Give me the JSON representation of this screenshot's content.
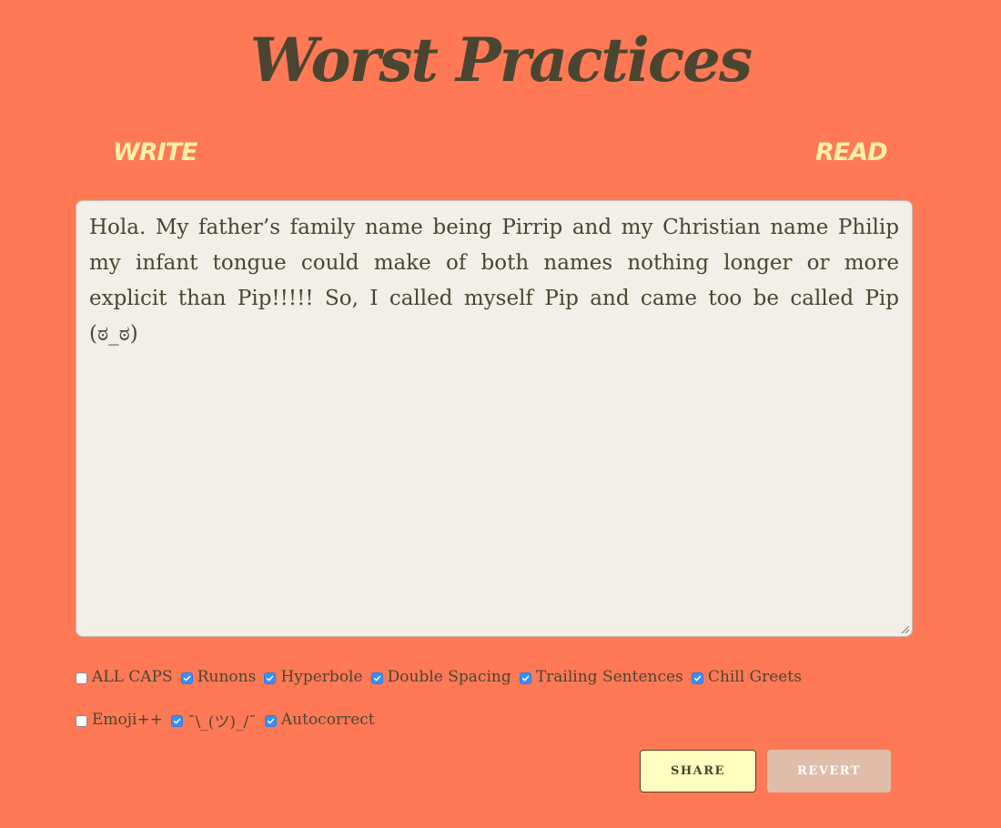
{
  "app": {
    "title": "Worst Practices"
  },
  "nav": {
    "write_label": "WRITE",
    "read_label": "READ"
  },
  "editor": {
    "text": "Hola. My father’s family name being Pirrip and my Christian name Philip my infant tongue could make of both names nothing longer or more explicit than Pip!!!!! So, I called myself Pip and came too be called Pip (ಠ_ಠ)"
  },
  "options": [
    {
      "label": "ALL CAPS",
      "checked": false
    },
    {
      "label": "Runons",
      "checked": true
    },
    {
      "label": "Hyperbole",
      "checked": true
    },
    {
      "label": "Double Spacing",
      "checked": true
    },
    {
      "label": "Trailing Sentences",
      "checked": true
    },
    {
      "label": "Chill Greets",
      "checked": true
    },
    {
      "label": "Emoji++",
      "checked": false
    },
    {
      "label": "¯\\_(ツ)_/¯",
      "checked": true
    },
    {
      "label": "Autocorrect",
      "checked": true
    }
  ],
  "buttons": {
    "share_label": "SHARE",
    "revert_label": "REVERT"
  },
  "colors": {
    "background": "#ff7956",
    "title": "#4a4530",
    "nav": "#fff0a6",
    "editor_bg": "#f2efe9",
    "checkbox_checked": "#3a8ef6",
    "share_bg": "#ffffbf",
    "revert_bg": "#dfbda9"
  }
}
